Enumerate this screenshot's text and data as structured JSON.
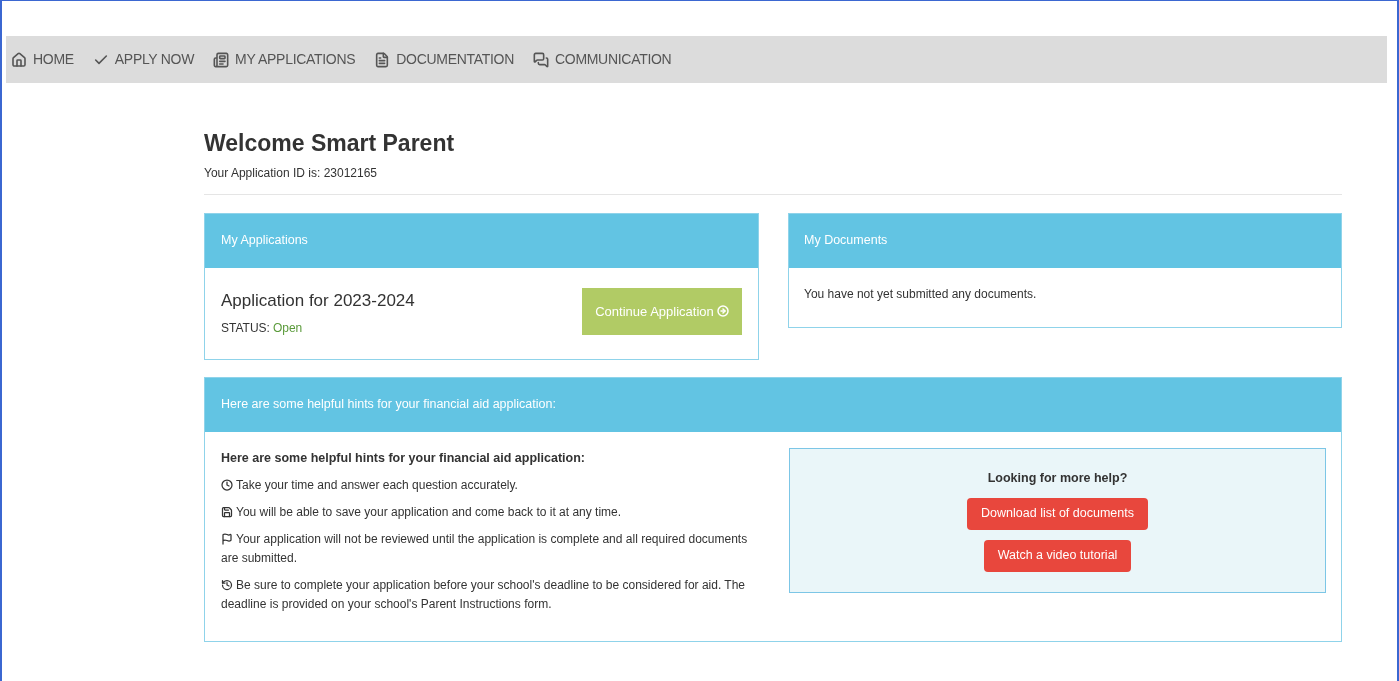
{
  "nav": [
    {
      "label": "HOME"
    },
    {
      "label": "APPLY NOW"
    },
    {
      "label": "MY APPLICATIONS"
    },
    {
      "label": "DOCUMENTATION"
    },
    {
      "label": "COMMUNICATION"
    }
  ],
  "welcome": {
    "title": "Welcome Smart Parent",
    "subtitle": "Your Application ID is: 23012165"
  },
  "applications": {
    "header": "My Applications",
    "title": "Application for 2023-2024",
    "status_label": "STATUS:",
    "status": "Open",
    "button": "Continue Application"
  },
  "documents": {
    "header": "My Documents",
    "message": "You have not yet submitted any documents."
  },
  "hints": {
    "header": "Here are some helpful hints for your financial aid application:",
    "heading": "Here are some helpful hints for your financial aid application:",
    "items": [
      "Take your time and answer each question accurately.",
      "You will be able to save your application and come back to it at any time.",
      "Your application will not be reviewed until the application is complete and all required documents are submitted.",
      "Be sure to complete your application before your school's deadline to be considered for aid. The deadline is provided on your school's Parent Instructions form."
    ],
    "help": {
      "title": "Looking for more help?",
      "buttons": [
        "Download list of documents",
        "Watch a video tutorial"
      ]
    }
  }
}
